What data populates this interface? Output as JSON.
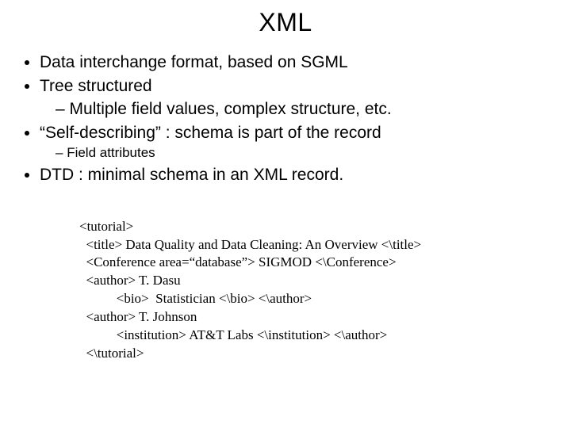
{
  "title": "XML",
  "bullets": {
    "b1": "Data interchange format, based on SGML",
    "b2": "Tree structured",
    "b2_sub": "Multiple field values, complex structure, etc.",
    "b3": "“Self-describing” : schema is part of the record",
    "b3_sub": "Field attributes",
    "b4": "DTD : minimal schema in an XML record."
  },
  "code": {
    "l1": "<tutorial>",
    "l2": "  <title> Data Quality and Data Cleaning: An Overview <\\title>",
    "l3": "  <Conference area=“database”> SIGMOD <\\Conference>",
    "l4": "  <author> T. Dasu",
    "l5": "           <bio>  Statistician <\\bio> <\\author>",
    "l6": "  <author> T. Johnson",
    "l7": "           <institution> AT&T Labs <\\institution> <\\author>",
    "l8": "  <\\tutorial>"
  }
}
